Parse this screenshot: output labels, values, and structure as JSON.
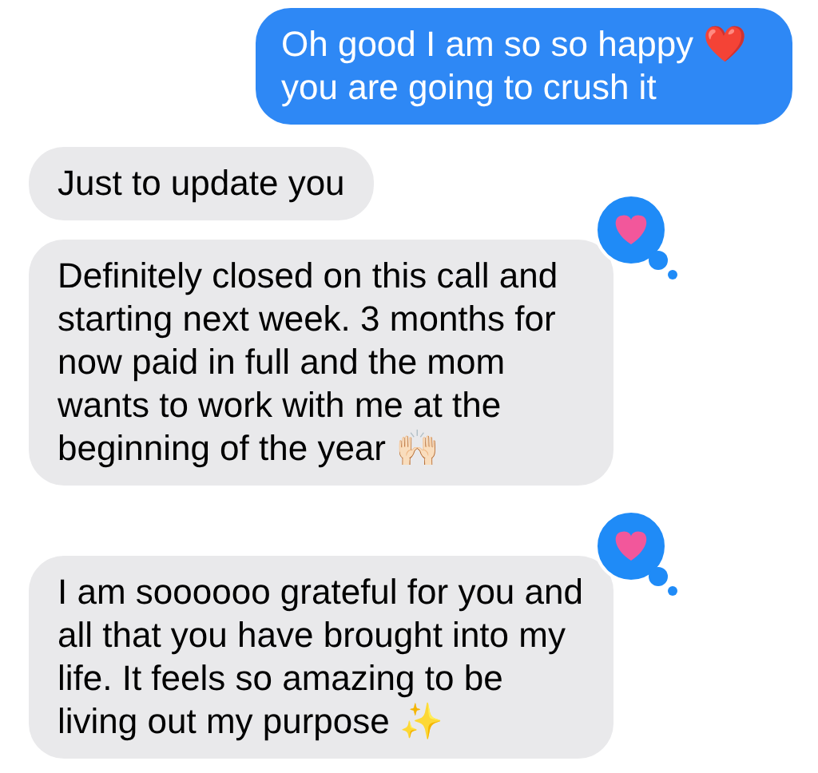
{
  "messages": [
    {
      "sent": true,
      "text": "Oh good I am so so happy ❤️ you are going to crush it",
      "liked": false
    },
    {
      "sent": false,
      "text": "Just to update you",
      "liked": false
    },
    {
      "sent": false,
      "text": "Definitely closed on this call and starting next week. 3 months for now paid in full and the mom wants to work with me at the beginning of the year 🙌🏻",
      "liked": true
    },
    {
      "sent": false,
      "text": "I am soooooo grateful for you and all that you have brought into my life. It feels so amazing to be living out my purpose ✨",
      "liked": true
    }
  ]
}
